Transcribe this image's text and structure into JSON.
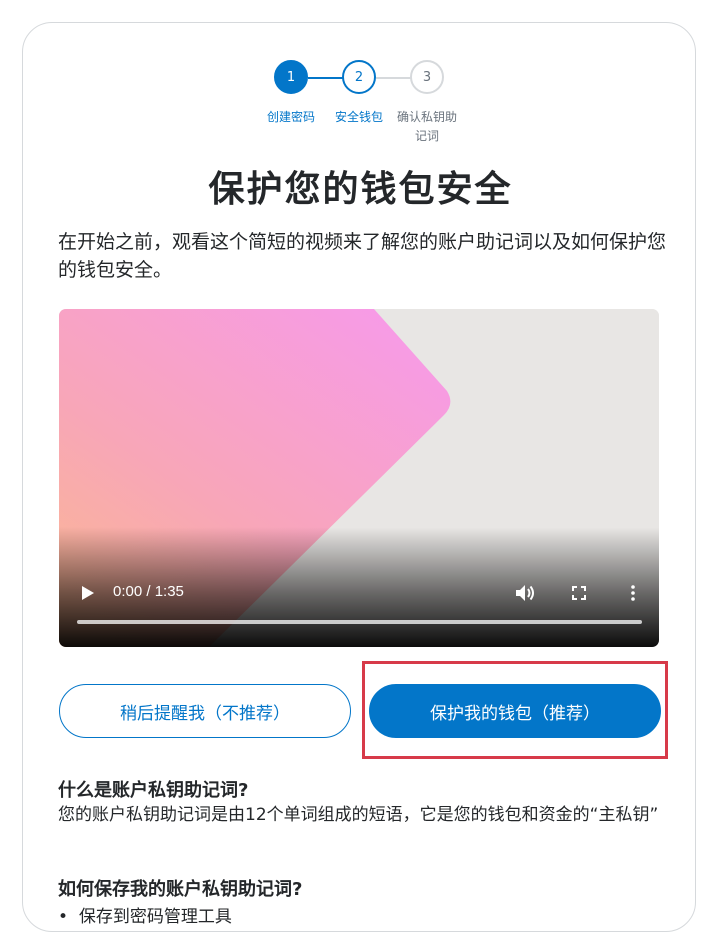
{
  "stepper": {
    "steps": [
      {
        "number": "1",
        "label": "创建密码",
        "state": "active"
      },
      {
        "number": "2",
        "label": "安全钱包",
        "state": "current"
      },
      {
        "number": "3",
        "label": "确认私钥助\n记词",
        "state": "inactive"
      }
    ]
  },
  "page": {
    "title": "保护您的钱包安全",
    "intro": "在开始之前，观看这个简短的视频来了解您的账户助记词以及如何保护您的钱包安全。"
  },
  "video": {
    "time_display": "0:00 / 1:35",
    "progress": 0,
    "icons": [
      "play-icon",
      "volume-icon",
      "fullscreen-icon",
      "more-options-icon"
    ]
  },
  "actions": {
    "remind_later_label": "稍后提醒我（不推荐）",
    "secure_wallet_label": "保护我的钱包（推荐）"
  },
  "faq": {
    "q1": "什么是账户私钥助记词?",
    "a1": "您的账户私钥助记词是由12个单词组成的短语，它是您的钱包和资金的“主私钥”",
    "q2": "如何保存我的账户私钥助记词?",
    "bullet1": "保存到密码管理工具"
  },
  "colors": {
    "accent": "#0376c9",
    "highlight_border": "#d73a49",
    "inactive": "#d6d9dc"
  }
}
